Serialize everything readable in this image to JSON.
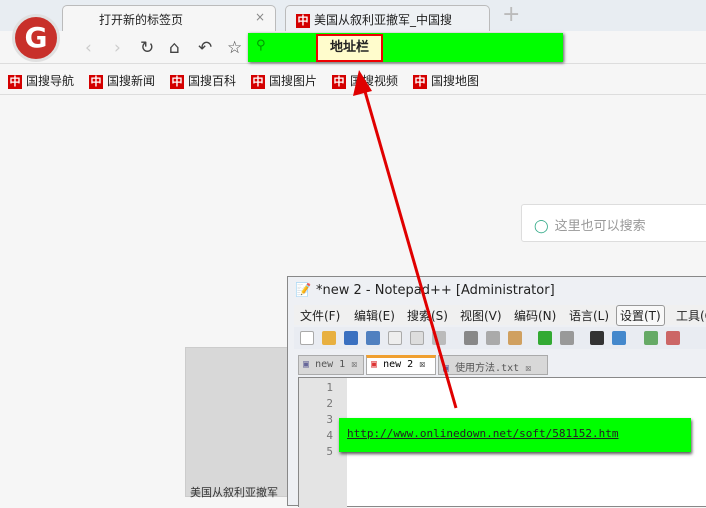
{
  "browser": {
    "tabs": [
      {
        "label": "打开新的标签页",
        "close": "×"
      },
      {
        "label": "美国从叙利亚撤军_中国搜",
        "icon": "中"
      }
    ],
    "new_tab": "+",
    "address_callout": "地址栏",
    "bookmarks": [
      {
        "icon": "中",
        "label": "国搜导航"
      },
      {
        "icon": "中",
        "label": "国搜新闻"
      },
      {
        "icon": "中",
        "label": "国搜百科"
      },
      {
        "icon": "中",
        "label": "国搜图片"
      },
      {
        "icon": "中",
        "label": "国搜视频"
      },
      {
        "icon": "中",
        "label": "国搜地图"
      }
    ],
    "search_placeholder": "这里也可以搜索",
    "card_caption": "美国从叙利亚撤军"
  },
  "notepad": {
    "title": "*new 2 - Notepad++ [Administrator]",
    "menu": [
      "文件(F)",
      "编辑(E)",
      "搜索(S)",
      "视图(V)",
      "编码(N)",
      "语言(L)",
      "设置(T)",
      "工具(O)"
    ],
    "tabs": [
      "new 1",
      "new 2",
      "使用方法.txt"
    ],
    "line_numbers": [
      "1",
      "2",
      "3",
      "4",
      "5"
    ],
    "url": "http://www.onlinedown.net/soft/581152.htm"
  },
  "colors": {
    "highlight": "#00ff00",
    "arrow": "#e00000"
  }
}
